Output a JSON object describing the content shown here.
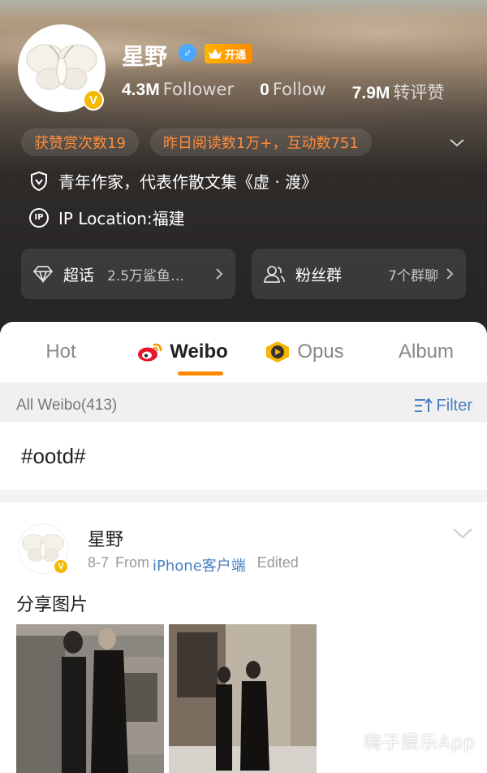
{
  "profile": {
    "name": "星野",
    "gender_symbol": "♂",
    "vip_label": "开通",
    "verified_symbol": "V",
    "stats": [
      {
        "value": "4.3M",
        "label": "Follower"
      },
      {
        "value": "0",
        "label": "Follow"
      },
      {
        "value": "7.9M",
        "label": "转评赞"
      }
    ],
    "pills": [
      "获赞赏次数19",
      "昨日阅读数1万+，互动数751"
    ],
    "bio": "青年作家，代表作散文集《虚 · 渡》",
    "ip_location": "IP Location:福建",
    "cards": [
      {
        "title": "超话",
        "value": "2.5万鲨鱼…"
      },
      {
        "title": "粉丝群",
        "value": "7个群聊"
      }
    ]
  },
  "tabs": [
    {
      "label": "Hot",
      "active": false
    },
    {
      "label": "Weibo",
      "active": true
    },
    {
      "label": "Opus",
      "active": false
    },
    {
      "label": "Album",
      "active": false
    }
  ],
  "filterbar": {
    "all_label": "All Weibo(413)",
    "filter_label": "Filter"
  },
  "topic": "#ootd#",
  "post": {
    "author": "星野",
    "date": "8-7",
    "from_label": "From",
    "source": "iPhone客户端",
    "edited": "Edited",
    "text": "分享图片"
  },
  "watermark": "嗨子娱乐App",
  "colors": {
    "accent": "#ff8a00",
    "link": "#4a7fc1",
    "verify": "#f5b800",
    "pill_text": "#ff8c3a"
  }
}
